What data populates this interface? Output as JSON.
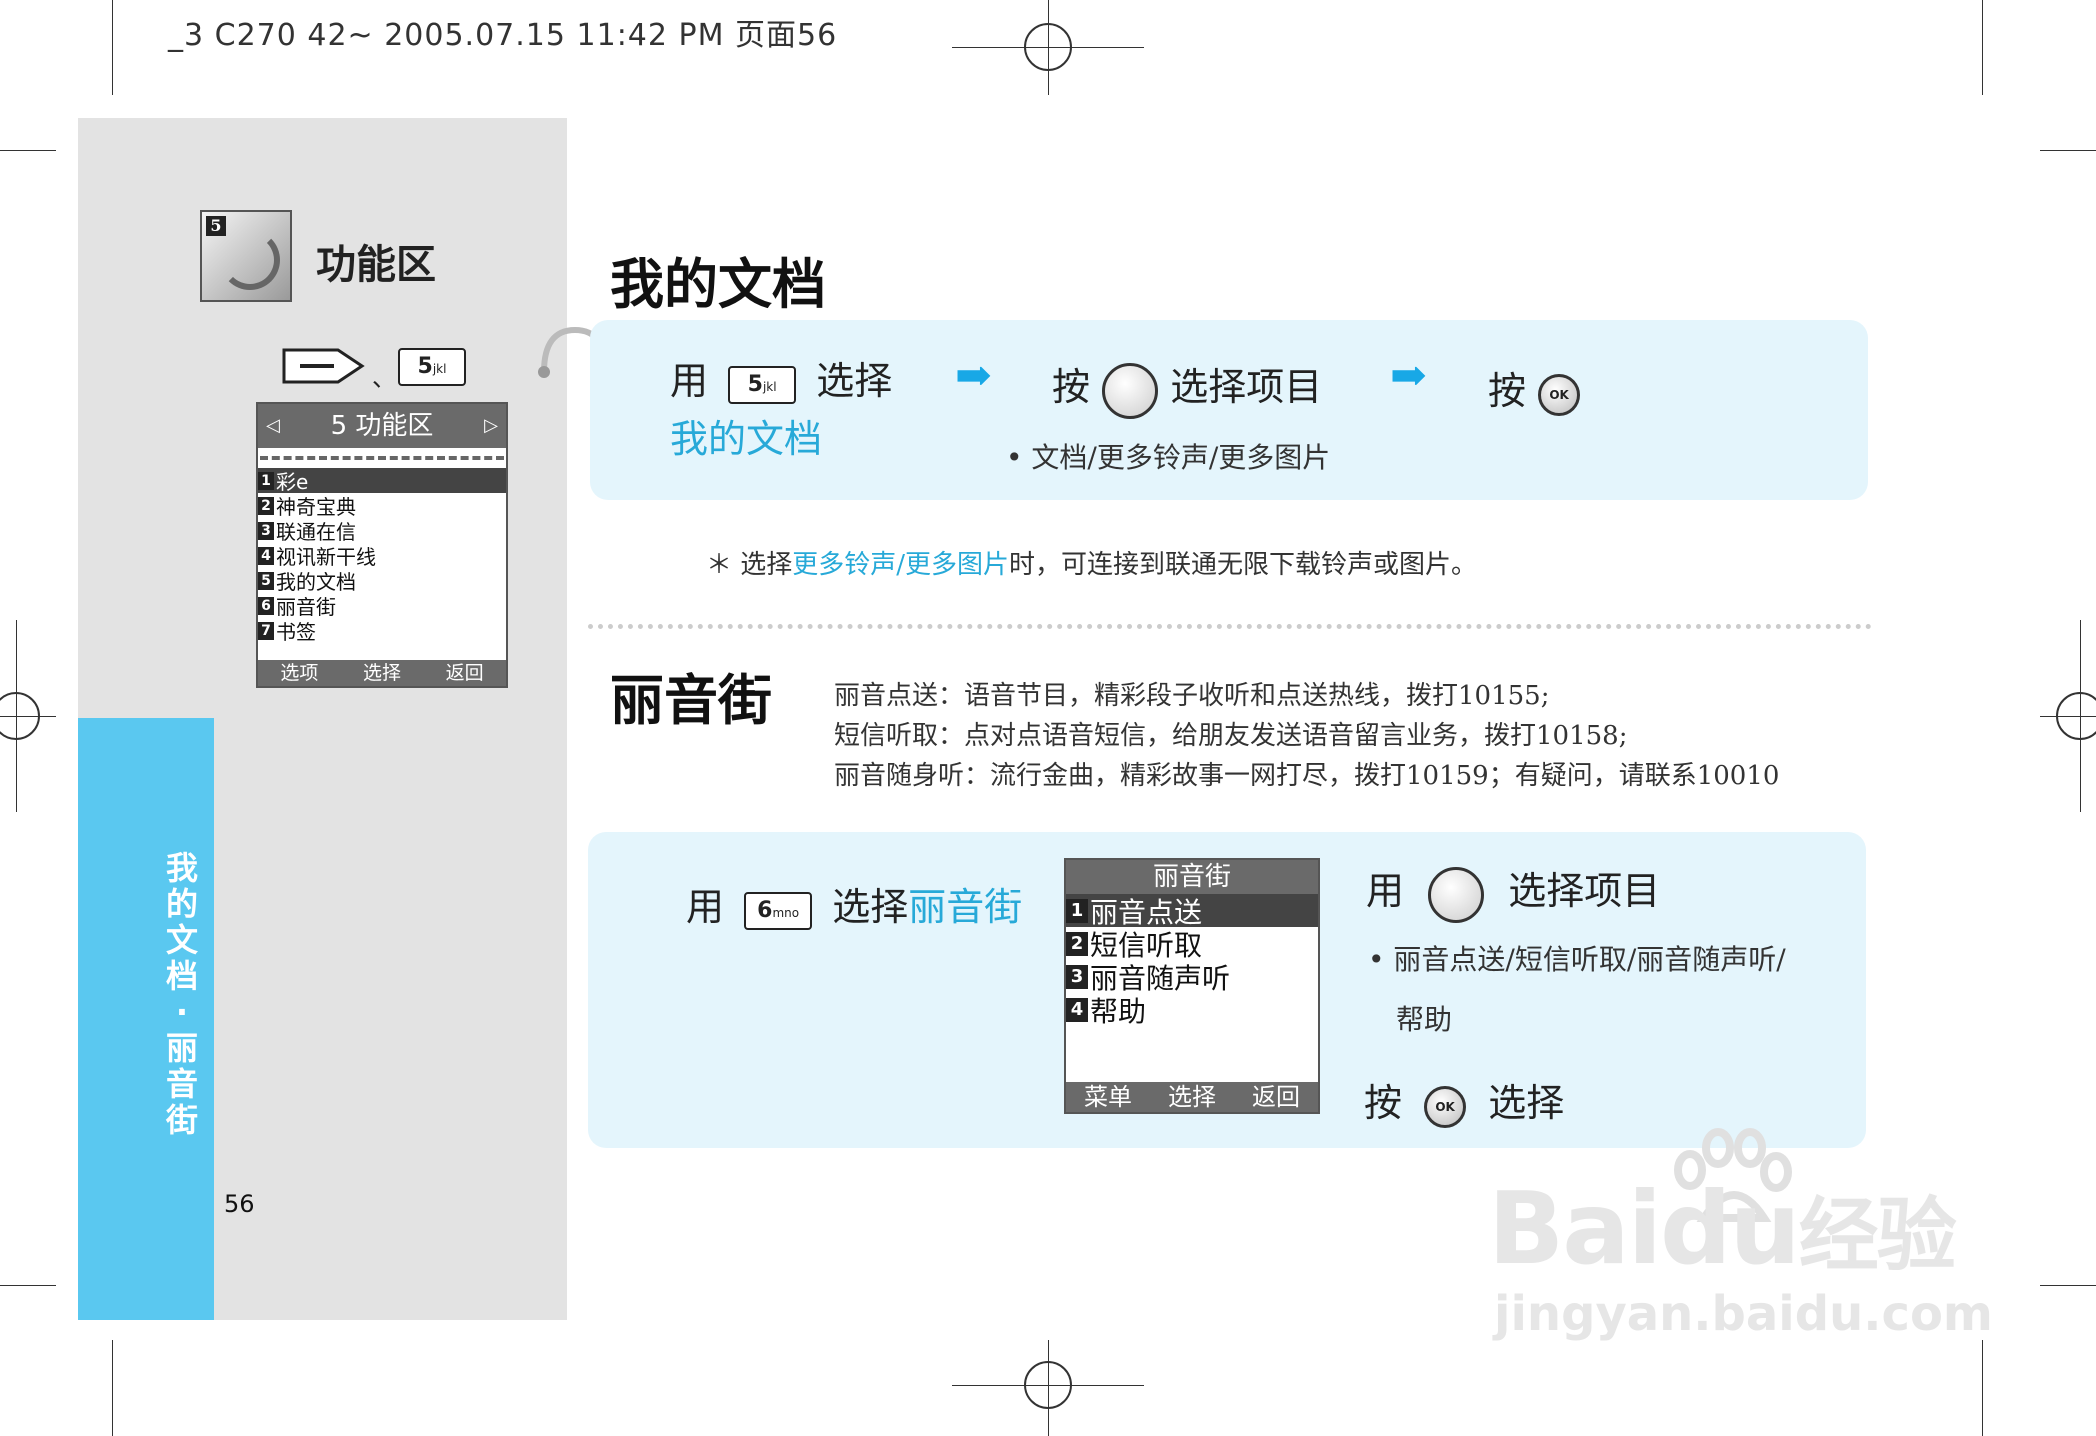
{
  "print_header": "_3 C270 42~ 2005.07.15 11:42 PM 页面56",
  "sidebar": {
    "func_icon_number": "5",
    "func_title": "功能区",
    "key_sep": "、",
    "key_num": "5",
    "key_sub": "jkl",
    "vertical_text": [
      "我",
      "的",
      "文",
      "档",
      "·",
      "丽",
      "音",
      "街"
    ],
    "page_number": "56"
  },
  "screen1": {
    "title": "5 功能区",
    "items": [
      {
        "num": "1",
        "label": "彩e"
      },
      {
        "num": "2",
        "label": "神奇宝典"
      },
      {
        "num": "3",
        "label": "联通在信"
      },
      {
        "num": "4",
        "label": "视讯新干线"
      },
      {
        "num": "5",
        "label": "我的文档"
      },
      {
        "num": "6",
        "label": "丽音街"
      },
      {
        "num": "7",
        "label": "书签"
      }
    ],
    "softkeys": [
      "选项",
      "选择",
      "返回"
    ]
  },
  "section1": {
    "title": "我的文档",
    "step1_prefix": "用",
    "step1_key": "5",
    "step1_key_sub": "jkl",
    "step1_suffix": "选择",
    "step1_target": "我的文档",
    "step2_prefix": "按",
    "step2_suffix": "选择项目",
    "step2_options": "• 文档/更多铃声/更多图片",
    "step3_prefix": "按",
    "ok_label": "OK",
    "note_star": "＊ 选择",
    "note_highlight": "更多铃声/更多图片",
    "note_rest": "时，可连接到联通无限下载铃声或图片。"
  },
  "section2": {
    "title": "丽音街",
    "desc": [
      "丽音点送：语音节目，精彩段子收听和点送热线，拨打10155;",
      "短信听取：点对点语音短信，给朋友发送语音留言业务，拨打10158;",
      "丽音随身听：流行金曲，精彩故事一网打尽，拨打10159；有疑问，请联系10010"
    ],
    "step1_prefix": "用",
    "step1_key": "6",
    "step1_key_sub": "mno",
    "step1_suffix": "选择",
    "step1_target": "丽音街",
    "step2_prefix": "用",
    "step2_suffix": "选择项目",
    "step2_options": "• 丽音点送/短信听取/丽音随声听/",
    "step2_options_2": "帮助",
    "step3_prefix": "按",
    "step3_suffix": "选择",
    "ok_label": "OK"
  },
  "screen2": {
    "title": "丽音街",
    "items": [
      {
        "num": "1",
        "label": "丽音点送"
      },
      {
        "num": "2",
        "label": "短信听取"
      },
      {
        "num": "3",
        "label": "丽音随声听"
      },
      {
        "num": "4",
        "label": "帮助"
      }
    ],
    "softkeys": [
      "菜单",
      "选择",
      "返回"
    ]
  },
  "watermark": {
    "brand": "Baidu",
    "suffix": "经验",
    "url": "jingyan.baidu.com"
  },
  "colors": {
    "accent_cyan": "#27a9d8",
    "panel_blue": "#e4f5fc",
    "strip_blue": "#5ac8f0",
    "panel_gray": "#e3e3e3"
  }
}
